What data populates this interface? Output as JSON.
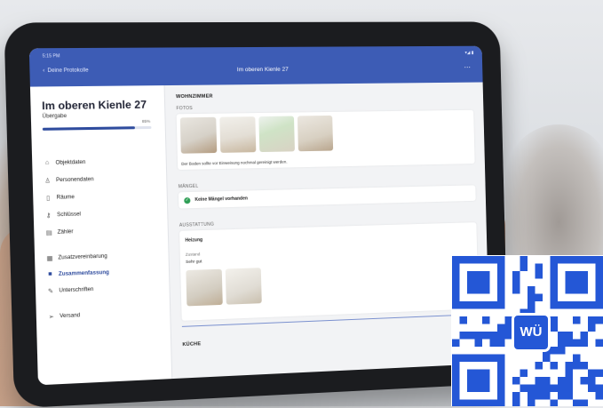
{
  "status": {
    "time": "5:15 PM",
    "icons": "▾◢ ▮"
  },
  "nav": {
    "back_label": "Deine Protokolle",
    "title": "Im oberen Kienle 27",
    "more": "⋯"
  },
  "sidebar": {
    "title": "Im oberen Kienle 27",
    "subtitle": "Übergabe",
    "progress_label": "85%",
    "progress_value": 0.85,
    "items": [
      {
        "label": "Objektdaten",
        "icon": "house-icon",
        "glyph": "⌂"
      },
      {
        "label": "Personendaten",
        "icon": "person-icon",
        "glyph": "♙"
      },
      {
        "label": "Räume",
        "icon": "rooms-icon",
        "glyph": "▯"
      },
      {
        "label": "Schlüssel",
        "icon": "key-icon",
        "glyph": "⚷"
      },
      {
        "label": "Zähler",
        "icon": "meter-icon",
        "glyph": "▤"
      },
      {
        "label": "Zusatzvereinbarung",
        "icon": "document-icon",
        "glyph": "▦"
      },
      {
        "label": "Zusammenfassung",
        "icon": "summary-icon",
        "glyph": "■"
      },
      {
        "label": "Unterschriften",
        "icon": "signature-icon",
        "glyph": "✎"
      },
      {
        "label": "Versand",
        "icon": "send-icon",
        "glyph": "➢"
      }
    ]
  },
  "main": {
    "room_title": "WOHNZIMMER",
    "photos_label": "FOTOS",
    "photo_note": "Der Boden sollte vor Einweisung nochmal gereinigt werden.",
    "defects_label": "MÄNGEL",
    "defects_text": "Keine Mängel vorhanden",
    "equipment_label": "AUSSTATTUNG",
    "heating_label": "Heizung",
    "condition_label": "Zustand",
    "condition_value": "Sehr gut",
    "next_room": "KÜCHE"
  },
  "qr": {
    "badge_text": "WÜ"
  },
  "colors": {
    "accent": "#3d5cb5",
    "active": "#2f4c9e",
    "ok": "#2e9e55",
    "qr_blue": "#2457d6"
  }
}
